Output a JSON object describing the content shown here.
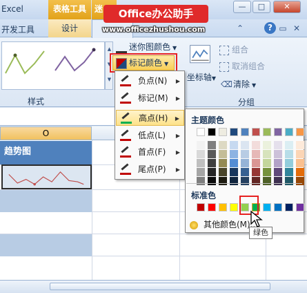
{
  "window": {
    "app_title": "Excel",
    "context_tab_group": "表格工具",
    "context_tab_group2": "迷",
    "minimize": "—",
    "restore": "□",
    "close": "✕"
  },
  "watermark": {
    "brand": "Office办公助手",
    "url": "www.officezhushou.com"
  },
  "tabs": {
    "dev_tools": "开发工具",
    "design": "设计",
    "help": "?"
  },
  "ribbon": {
    "group_style_label": "样式",
    "sparkline_color": "迷你图颜色",
    "marker_color": "标记颜色",
    "axis": "坐标轴",
    "combine": "组合",
    "ungroup": "取消组合",
    "clear": "清除",
    "group_group_label": "分组"
  },
  "sheet": {
    "column_header": "O",
    "title_cell": "趋势图"
  },
  "menu": {
    "items": [
      {
        "label": "负点(N)"
      },
      {
        "label": "标记(M)"
      },
      {
        "label": "高点(H)"
      },
      {
        "label": "低点(L)"
      },
      {
        "label": "首点(F)"
      },
      {
        "label": "尾点(P)"
      }
    ],
    "active_index": 2
  },
  "palette": {
    "theme_title": "主题颜色",
    "standard_title": "标准色",
    "more_colors": "其他颜色(M)...",
    "tooltip": "绿色",
    "theme_top": [
      "#ffffff",
      "#000000",
      "#eeece1",
      "#1f497d",
      "#4f81bd",
      "#c0504d",
      "#9bbb59",
      "#8064a2",
      "#4bacc6",
      "#f79646"
    ],
    "theme_shades": [
      [
        "#f2f2f2",
        "#d9d9d9",
        "#bfbfbf",
        "#a5a5a5",
        "#7f7f7f"
      ],
      [
        "#7f7f7f",
        "#595959",
        "#3f3f3f",
        "#262626",
        "#0c0c0c"
      ],
      [
        "#ddd9c3",
        "#c4bd97",
        "#948a54",
        "#4a452a",
        "#1d1b10"
      ],
      [
        "#c6d9f0",
        "#8db3e2",
        "#548dd4",
        "#17365d",
        "#0f243e"
      ],
      [
        "#dbe5f1",
        "#b8cce4",
        "#95b3d7",
        "#366092",
        "#244061"
      ],
      [
        "#f2dcdb",
        "#e6b8b7",
        "#da9694",
        "#963634",
        "#632523"
      ],
      [
        "#ebf1dd",
        "#d7e3bc",
        "#c3d69b",
        "#76923c",
        "#4f6128"
      ],
      [
        "#e5e0ec",
        "#ccc1d9",
        "#b2a2c7",
        "#5f497a",
        "#3f3151"
      ],
      [
        "#dbeef3",
        "#b7dde8",
        "#92cddc",
        "#31859b",
        "#205867"
      ],
      [
        "#fdeada",
        "#fbd5b5",
        "#fac08f",
        "#e36c09",
        "#974806"
      ]
    ],
    "standard": [
      "#c00000",
      "#ff0000",
      "#ffc000",
      "#ffff00",
      "#92d050",
      "#00b050",
      "#00b0f0",
      "#0070c0",
      "#002060",
      "#7030a0"
    ]
  }
}
